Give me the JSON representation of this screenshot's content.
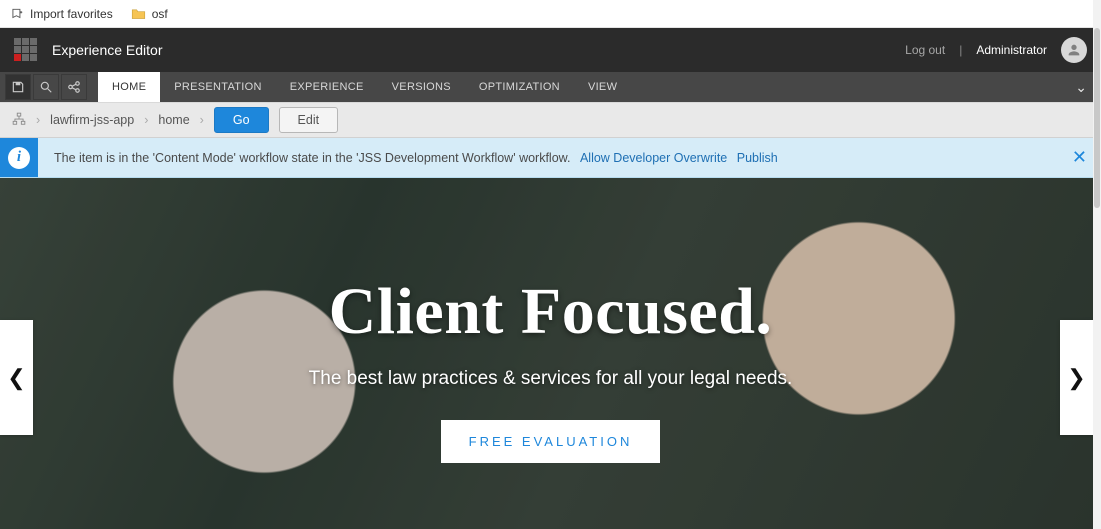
{
  "bookmarks": {
    "import": "Import favorites",
    "osf": "osf"
  },
  "app": {
    "title": "Experience Editor",
    "logout": "Log out",
    "user": "Administrator"
  },
  "ribbon": {
    "tabs": [
      "HOME",
      "PRESENTATION",
      "EXPERIENCE",
      "VERSIONS",
      "OPTIMIZATION",
      "VIEW"
    ],
    "active": "HOME"
  },
  "path": {
    "items": [
      "lawfirm-jss-app",
      "home"
    ],
    "go": "Go",
    "edit": "Edit"
  },
  "message": {
    "text": "The item is in the 'Content Mode' workflow state in the 'JSS Development Workflow' workflow.",
    "link1": "Allow Developer Overwrite",
    "link2": "Publish",
    "info_glyph": "i"
  },
  "hero": {
    "title": "Client Focused.",
    "sub": "The best law practices & services for all your legal needs.",
    "cta": "FREE EVALUATION"
  }
}
